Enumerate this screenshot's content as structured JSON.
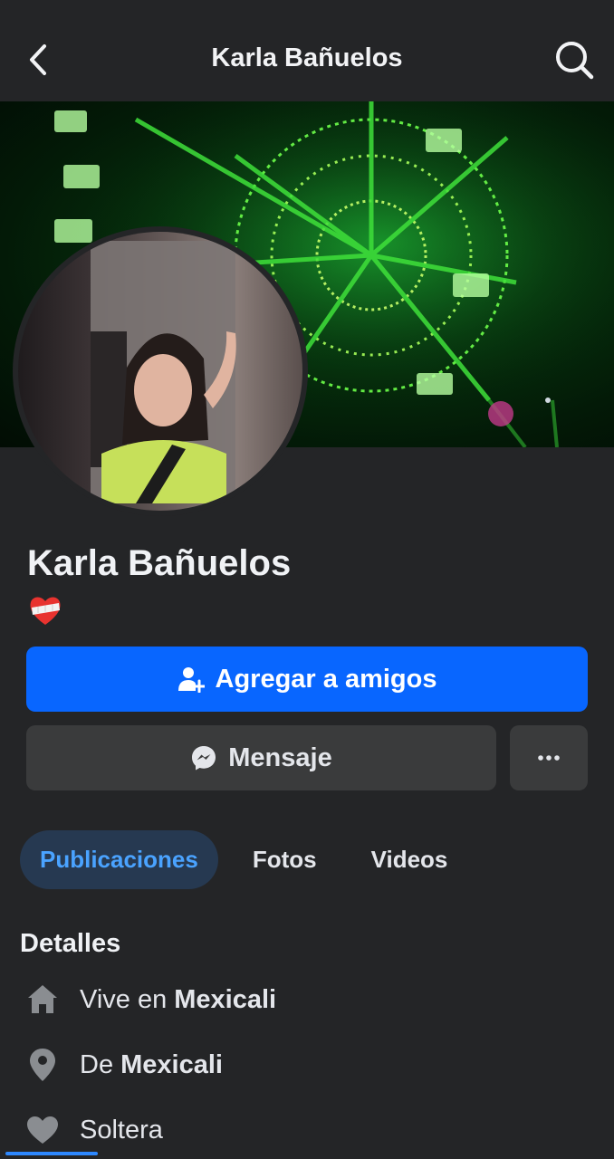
{
  "header": {
    "title": "Karla Bañuelos",
    "back_icon": "chevron-left-icon",
    "search_icon": "search-icon"
  },
  "profile": {
    "name": "Karla Bañuelos",
    "bio_emoji": "❤️‍🩹"
  },
  "actions": {
    "add_friend_label": "Agregar a amigos",
    "message_label": "Mensaje",
    "more_label": "···"
  },
  "tabs": [
    {
      "label": "Publicaciones",
      "active": true
    },
    {
      "label": "Fotos",
      "active": false
    },
    {
      "label": "Videos",
      "active": false
    }
  ],
  "details": {
    "title": "Detalles",
    "items": [
      {
        "icon": "home-icon",
        "prefix": "Vive en ",
        "value": "Mexicali"
      },
      {
        "icon": "location-pin-icon",
        "prefix": "De ",
        "value": "Mexicali"
      },
      {
        "icon": "heart-icon",
        "prefix": "Soltera",
        "value": ""
      }
    ]
  },
  "colors": {
    "background": "#242527",
    "primary_button": "#0866ff",
    "secondary_button": "#3a3b3c",
    "active_tab_bg": "#263951",
    "active_tab_text": "#4aa3ff"
  }
}
